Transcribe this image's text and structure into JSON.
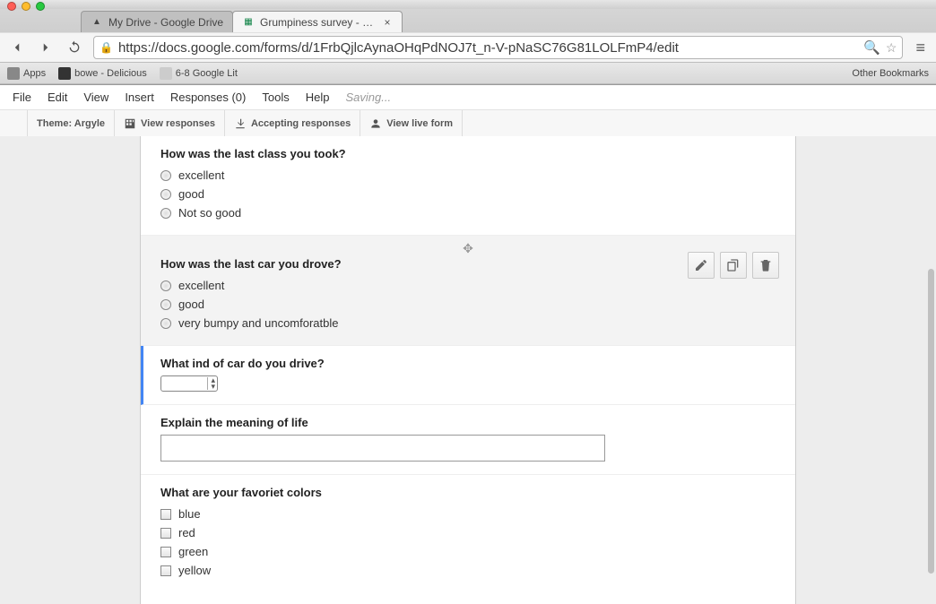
{
  "browser": {
    "tabs": [
      {
        "title": "My Drive - Google Drive",
        "active": false
      },
      {
        "title": "Grumpiness survey - Goog",
        "active": true
      }
    ],
    "url": "https://docs.google.com/forms/d/1FrbQjlcAynaOHqPdNOJ7t_n-V-pNaSC76G81LOLFmP4/edit",
    "bookmarks": {
      "apps": "Apps",
      "items": [
        "bowe - Delicious",
        "6-8 Google Lit"
      ],
      "other": "Other Bookmarks"
    }
  },
  "menu": {
    "file": "File",
    "edit": "Edit",
    "view": "View",
    "insert": "Insert",
    "responses": "Responses (0)",
    "tools": "Tools",
    "help": "Help",
    "saving": "Saving..."
  },
  "toolbar": {
    "theme": "Theme: Argyle",
    "view_responses": "View responses",
    "accepting": "Accepting responses",
    "view_live": "View live form"
  },
  "questions": [
    {
      "title": "How was the last class you took?",
      "type": "radio",
      "options": [
        "excellent",
        "good",
        "Not so good"
      ]
    },
    {
      "title": "How was the last car you drove?",
      "type": "radio",
      "hover": true,
      "options": [
        "excellent",
        "good",
        "very bumpy and uncomforatble"
      ]
    },
    {
      "title": "What ind of car do you drive?",
      "type": "dropdown",
      "selected_left": true
    },
    {
      "title": "Explain the meaning of life",
      "type": "paragraph"
    },
    {
      "title": "What are your favoriet colors",
      "type": "checkbox",
      "options": [
        "blue",
        "red",
        "green",
        "yellow"
      ]
    }
  ]
}
